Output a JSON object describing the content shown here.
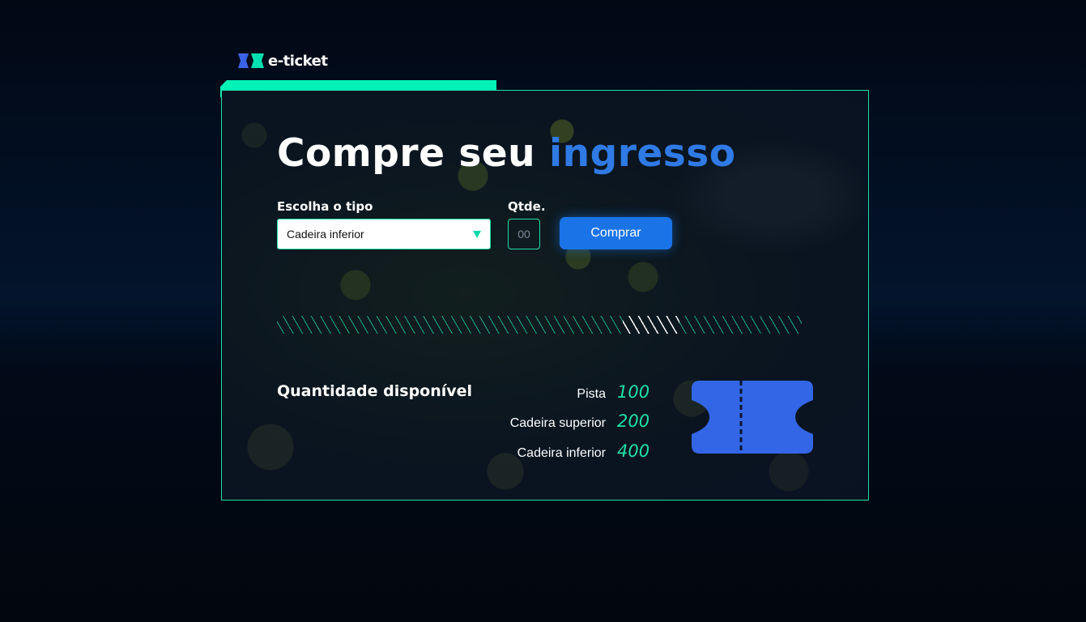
{
  "brand": {
    "name": "e-ticket",
    "icon": "ticket-logo-icon"
  },
  "colors": {
    "accent_green": "#1ee0a6",
    "accent_blue": "#1a74e8",
    "headline_blue": "#2f7ae5",
    "ticket_blue": "#3366e6"
  },
  "headline": {
    "part1": "Compre seu",
    "part2": "ingresso"
  },
  "form": {
    "type_label": "Escolha o tipo",
    "type_value": "Cadeira inferior",
    "qty_label": "Qtde.",
    "qty_placeholder": "00",
    "buy_label": "Comprar"
  },
  "availability": {
    "title": "Quantidade disponível",
    "items": [
      {
        "label": "Pista",
        "value": "100"
      },
      {
        "label": "Cadeira superior",
        "value": "200"
      },
      {
        "label": "Cadeira inferior",
        "value": "400"
      }
    ],
    "icon": "ticket-icon"
  }
}
